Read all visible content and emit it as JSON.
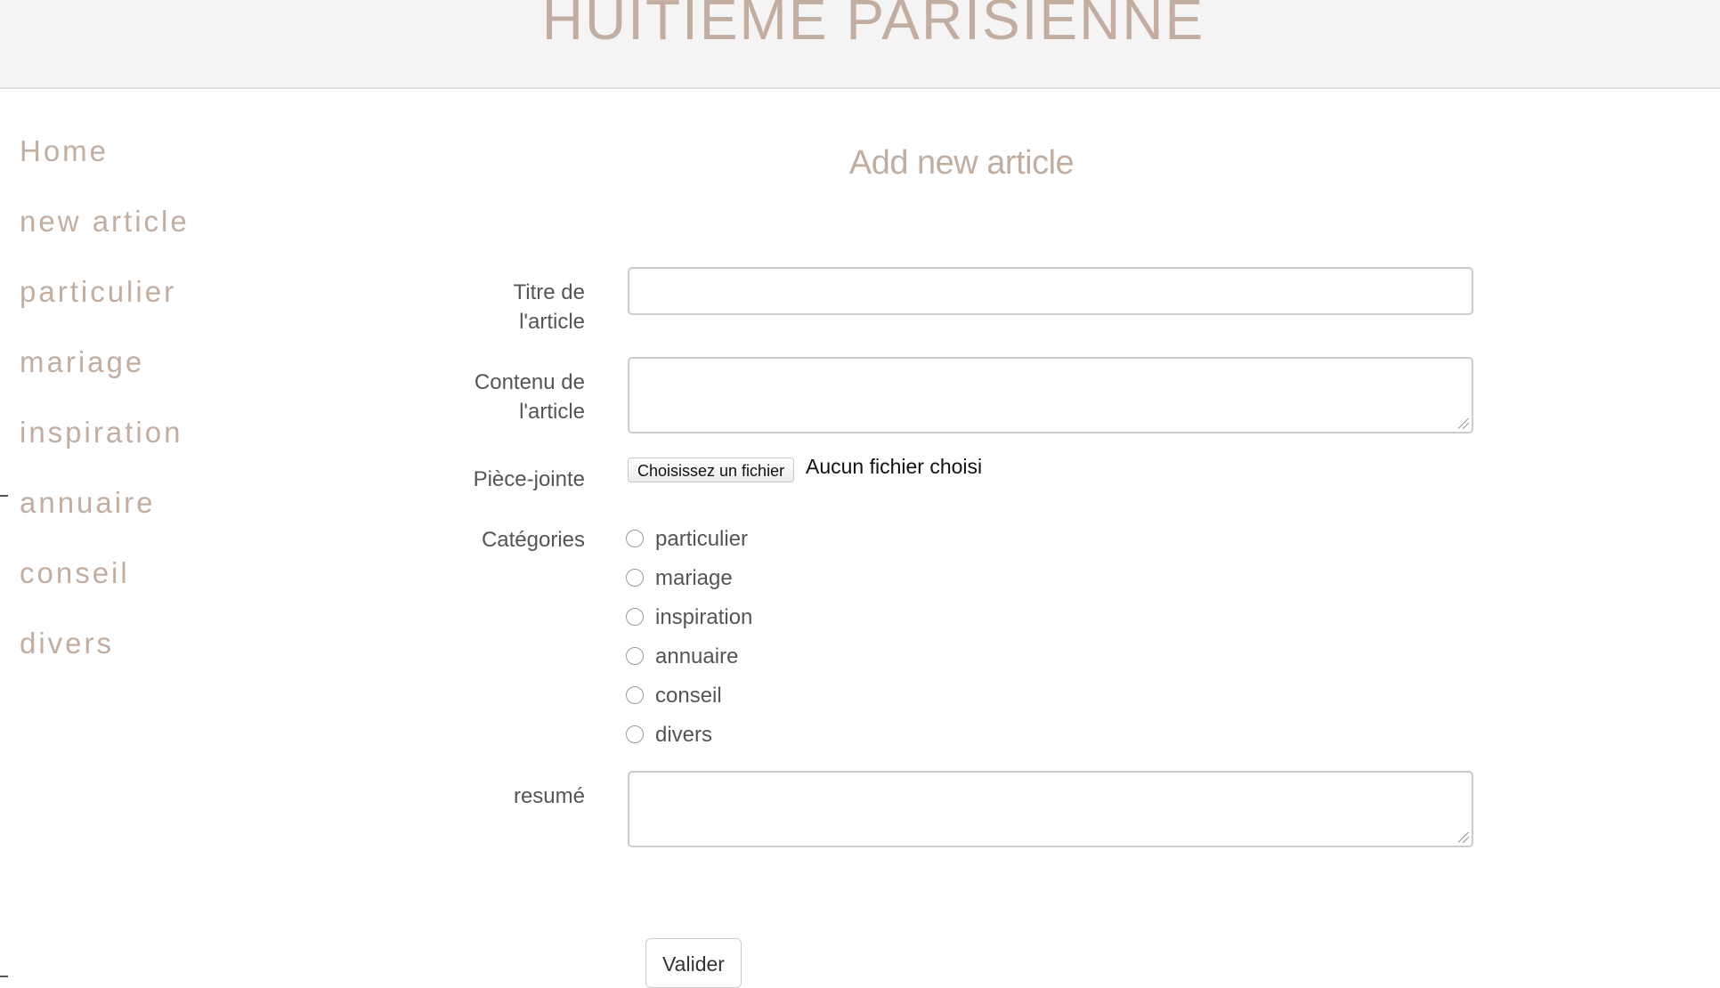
{
  "header": {
    "site_title": "HUITIEME PARISIENNE"
  },
  "sidebar": {
    "items": [
      {
        "label": "Home"
      },
      {
        "label": "new article"
      },
      {
        "label": "particulier"
      },
      {
        "label": "mariage"
      },
      {
        "label": "inspiration"
      },
      {
        "label": "annuaire"
      },
      {
        "label": "conseil"
      },
      {
        "label": "divers"
      }
    ]
  },
  "form": {
    "heading": "Add new article",
    "title_label_line1": "Titre de",
    "title_label_line2": "l'article",
    "title_value": "",
    "content_label_line1": "Contenu de",
    "content_label_line2": "l'article",
    "content_value": "",
    "attachment_label": "Pièce-jointe",
    "file_button_label": "Choisissez un fichier",
    "file_status": "Aucun fichier choisi",
    "categories_label": "Catégories",
    "categories": [
      {
        "label": "particulier",
        "checked": false
      },
      {
        "label": "mariage",
        "checked": false
      },
      {
        "label": "inspiration",
        "checked": false
      },
      {
        "label": "annuaire",
        "checked": false
      },
      {
        "label": "conseil",
        "checked": false
      },
      {
        "label": "divers",
        "checked": false
      }
    ],
    "summary_label": "resumé",
    "summary_value": "",
    "submit_label": "Valider"
  },
  "colors": {
    "accent": "#c2aea0",
    "label_text": "#555555",
    "header_bg": "#f4f4f4"
  }
}
